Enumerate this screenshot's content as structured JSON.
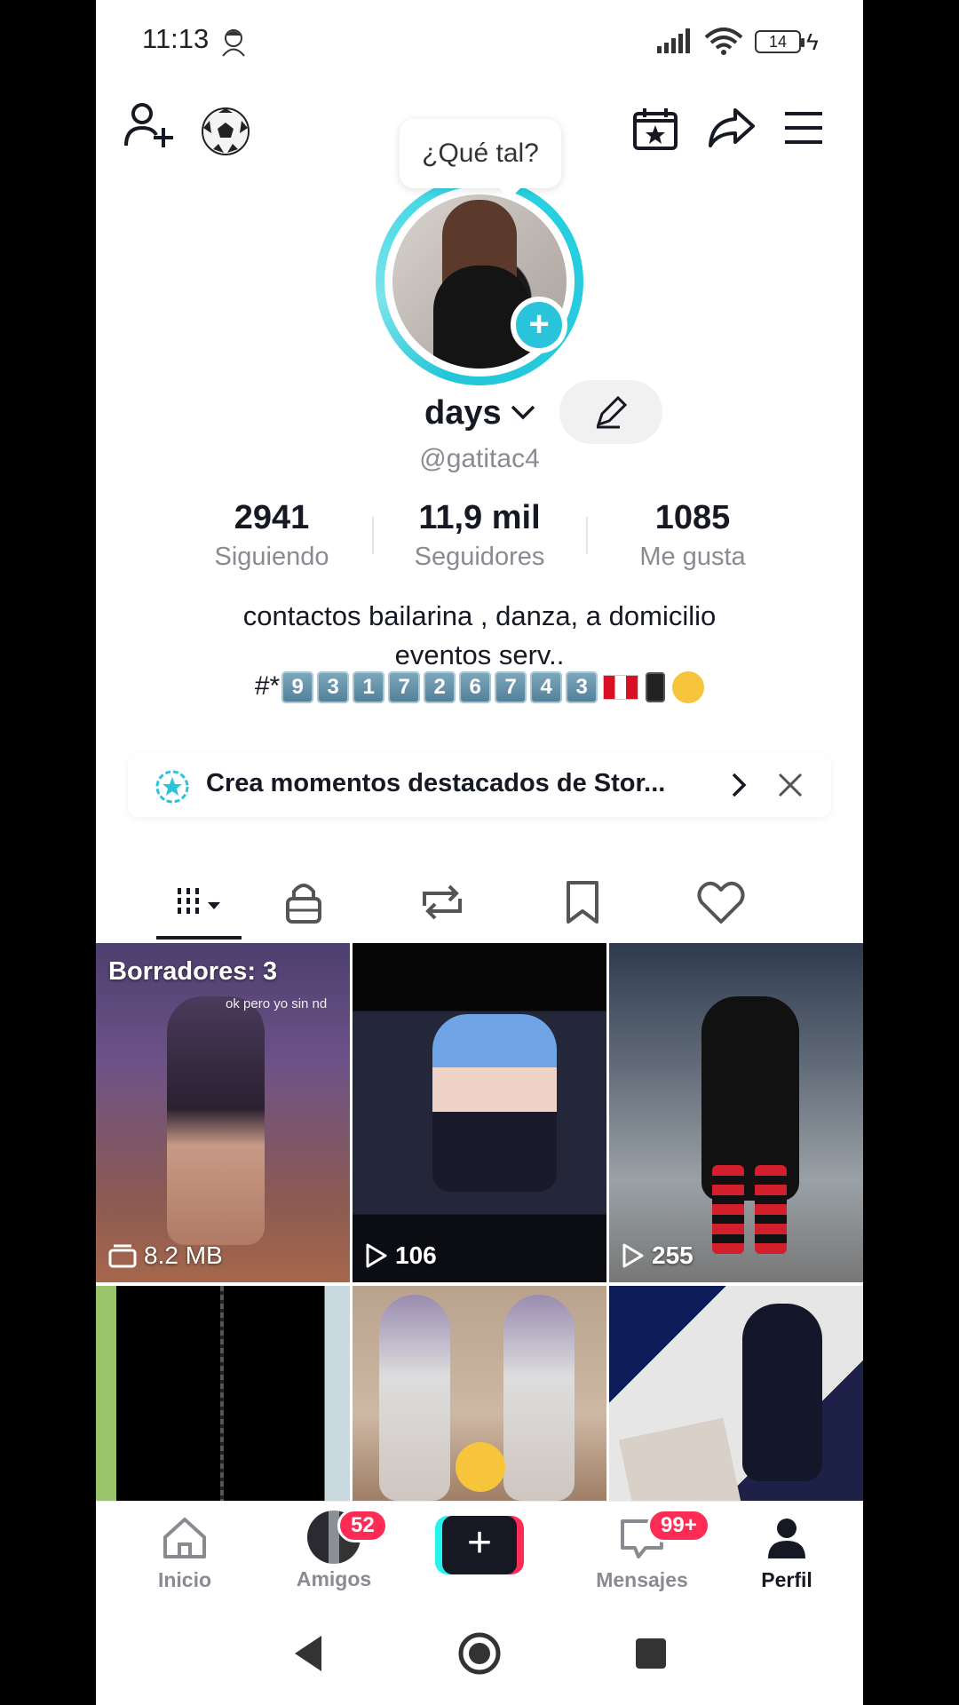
{
  "status_bar": {
    "time": "11:13",
    "battery": "14",
    "icons": [
      "notification-avatar-icon",
      "signal-icon",
      "wifi-icon",
      "battery-icon",
      "charging-icon"
    ]
  },
  "top_bar": {
    "icons": [
      "add-friend-icon",
      "soccer-ball-icon",
      "calendar-star-icon",
      "share-icon",
      "menu-icon"
    ]
  },
  "profile": {
    "bubble_text": "¿Qué tal?",
    "display_name": "days",
    "handle": "@gatitac4",
    "stats": [
      {
        "value": "2941",
        "label": "Siguiendo"
      },
      {
        "value": "11,9 mil",
        "label": "Seguidores"
      },
      {
        "value": "1085",
        "label": "Me gusta"
      }
    ],
    "bio_line1": "contactos bailarina , danza, a domicilio",
    "bio_line2": "eventos serv..",
    "bio_line3_prefix": "#*",
    "bio_digits": [
      "9",
      "3",
      "1",
      "7",
      "2",
      "6",
      "7",
      "4",
      "3"
    ]
  },
  "banner": {
    "text": "Crea momentos destacados de Stor..."
  },
  "tabs": [
    "videos-grid-tab",
    "private-tab",
    "reposts-tab",
    "favorites-tab",
    "liked-tab"
  ],
  "grid": [
    {
      "overlay": "8.2 MB",
      "label": "Borradores: 3",
      "caption": "ok pero yo sin nd"
    },
    {
      "overlay": "106"
    },
    {
      "overlay": "255"
    },
    {
      "overlay": ""
    },
    {
      "overlay": ""
    },
    {
      "overlay": ""
    }
  ],
  "bottom_nav": {
    "home": "Inicio",
    "friends": "Amigos",
    "friends_badge": "52",
    "messages": "Mensajes",
    "messages_badge": "99+",
    "profile": "Perfil"
  },
  "colors": {
    "accent_cyan": "#25f4ee",
    "accent_pink": "#fe2c55",
    "ring": "#29d2e4",
    "text_primary": "#161823",
    "text_secondary": "#8a8b91"
  }
}
